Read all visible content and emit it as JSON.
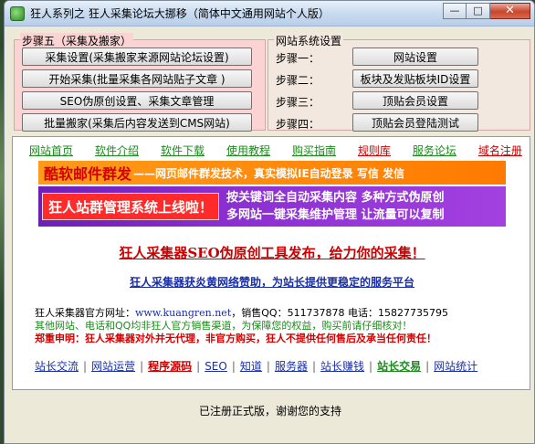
{
  "window": {
    "title": "狂人系列之 狂人采集论坛大挪移（简体中文通用网站个人版）",
    "minimize_glyph": "—",
    "maximize_glyph": "□",
    "close_glyph": "✕"
  },
  "group_left": {
    "title": "步骤五（采集及搬家）",
    "buttons": [
      "采集设置(采集搬家来源网站论坛设置)",
      "开始采集(批量采集各网站贴子文章 )",
      "SEO伪原创设置、采集文章管理",
      "批量搬家(采集后内容发送到CMS网站)"
    ]
  },
  "group_right": {
    "title": "网站系统设置",
    "steps": [
      {
        "label": "步骤一：",
        "button": "网站设置"
      },
      {
        "label": "步骤二：",
        "button": "板块及发贴板块ID设置"
      },
      {
        "label": "步骤三：",
        "button": "顶贴会员设置"
      },
      {
        "label": "步骤四：",
        "button": "顶贴会员登陆测试"
      }
    ]
  },
  "nav": [
    {
      "label": "网站首页",
      "style": "green"
    },
    {
      "label": "软件介绍",
      "style": "green"
    },
    {
      "label": "软件下载",
      "style": "green"
    },
    {
      "label": "使用教程",
      "style": "green"
    },
    {
      "label": "购买指南",
      "style": "green"
    },
    {
      "label": "规则库",
      "style": "red"
    },
    {
      "label": "服务论坛",
      "style": "green"
    },
    {
      "label": "域名注册",
      "style": "red"
    }
  ],
  "banner1": {
    "title": "酷软邮件群发",
    "subtitle": "——网页邮件群发技术，真实模拟IE自动登录 写信 发信"
  },
  "banner2": {
    "left": "狂人站群管理系统上线啦！",
    "right_line1": "按关键词全自动采集内容  多种方式伪原创",
    "right_line2": "多网站一键采集维护管理  让流量可以复制"
  },
  "headline": "狂人采集器SEO伪原创工具发布，给力你的采集！",
  "subline": "狂人采集器获炎黄网络赞助，为站长提供更稳定的服务平台",
  "info": {
    "line1_prefix": "狂人采集器官方网址：",
    "line1_url": "www.kuangren.net",
    "line1_suffix": "，销售QQ：511737878 电话：15827735795",
    "line2": "其他网站、电话和QQ均非狂人官方销售渠道，为保障您的权益，购买前请仔细核对！",
    "line3": "郑重申明：狂人采集器对外并无代理，非官方购买，狂人不提供任何售后及承当任何责任！"
  },
  "links": [
    {
      "label": "站长交流",
      "style": "blue"
    },
    {
      "label": "网站运营",
      "style": "blue"
    },
    {
      "label": "程序源码",
      "style": "red"
    },
    {
      "label": "SEO",
      "style": "blue"
    },
    {
      "label": "知道",
      "style": "blue"
    },
    {
      "label": "服务器",
      "style": "blue"
    },
    {
      "label": "站长赚钱",
      "style": "blue"
    },
    {
      "label": "站长交易",
      "style": "green"
    },
    {
      "label": "网站统计",
      "style": "blue"
    }
  ],
  "status": "已注册正式版，谢谢您的支持"
}
